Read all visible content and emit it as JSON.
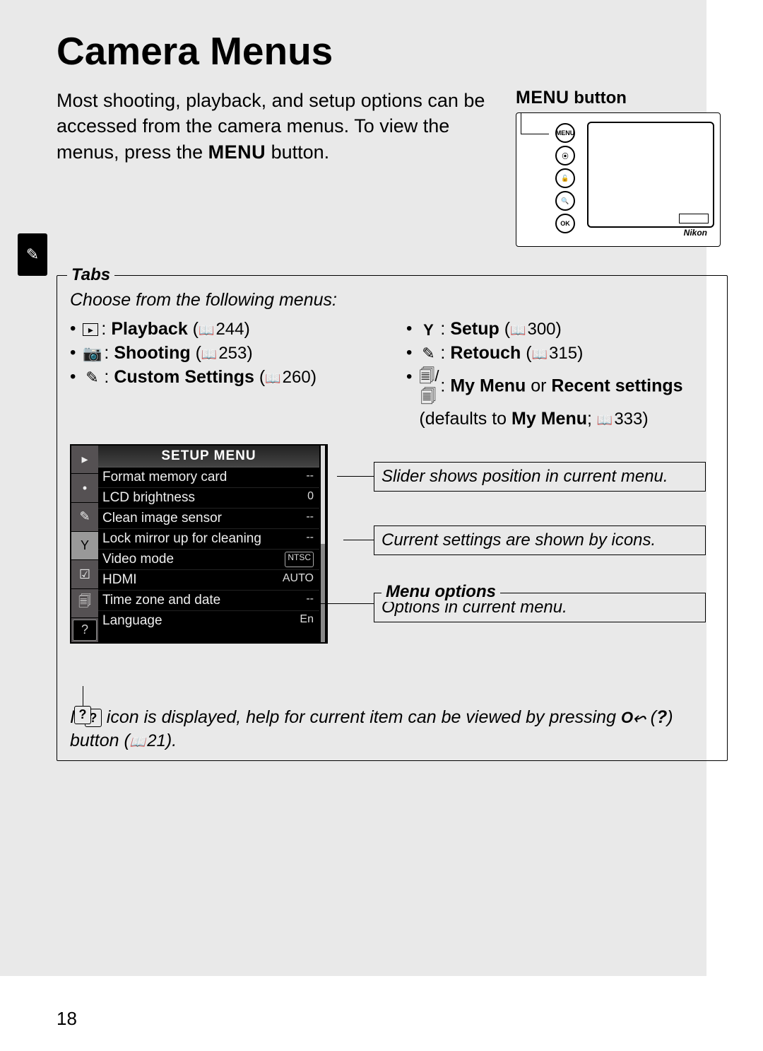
{
  "page": {
    "title": "Camera Menus",
    "number": "18"
  },
  "intro": {
    "text_pre": "Most shooting, playback, and setup options can be accessed from the camera menus.  To view the menus, press the ",
    "menu_word": "MENU",
    "text_post": " button."
  },
  "camera": {
    "label_menu": "MENU",
    "label_button": " button",
    "brand": "Nikon",
    "buttons": [
      "MENU",
      "⦿",
      "🔓",
      "🔍",
      "OK"
    ]
  },
  "tabs": {
    "heading": "Tabs",
    "subtitle": "Choose from the following menus:",
    "left": [
      {
        "icon": "▸",
        "label": "Playback",
        "page": "244"
      },
      {
        "icon": "📷",
        "label": "Shooting",
        "page": "253"
      },
      {
        "icon": "✎",
        "label": "Custom Settings",
        "page": "260"
      }
    ],
    "right": [
      {
        "icon": "Y",
        "label": "Setup",
        "page": "300",
        "simple": true
      },
      {
        "icon": "✎",
        "label": "Retouch",
        "page": "315",
        "simple": true
      },
      {
        "icon": "🗐/🗐",
        "label": "My Menu",
        "label2": " or ",
        "label3": "Recent settings",
        "defaults_pre": "(defaults to ",
        "defaults_bold": "My Menu",
        "defaults_post": "; ",
        "page": "333"
      }
    ]
  },
  "lcd": {
    "title": "SETUP MENU",
    "rows": [
      {
        "name": "Format memory card",
        "val": "--"
      },
      {
        "name": "LCD brightness",
        "val": "0"
      },
      {
        "name": "Clean image sensor",
        "val": "--"
      },
      {
        "name": "Lock mirror up for cleaning",
        "val": "--"
      },
      {
        "name": "Video mode",
        "val": "NTSC",
        "box": true
      },
      {
        "name": "HDMI",
        "val": "AUTO"
      },
      {
        "name": "Time zone and date",
        "val": "--"
      },
      {
        "name": "Language",
        "val": "En"
      }
    ]
  },
  "callouts": {
    "slider": "Slider shows position in current menu.",
    "settings": "Current settings are shown by icons.",
    "options_title": "Menu options",
    "options_text": "Options in current menu."
  },
  "help": {
    "pre": "If ",
    "mid": " icon is displayed, help for current item can be viewed by pressing ",
    "key": "O⬿",
    "post1": " (",
    "qmark": "?",
    "post2": ") button (",
    "page": "21",
    "post3": ")."
  }
}
